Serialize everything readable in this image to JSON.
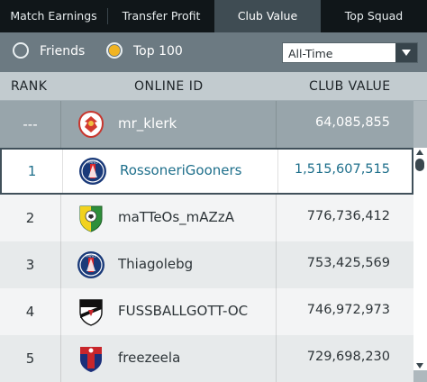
{
  "tabs": [
    {
      "label": "Match Earnings"
    },
    {
      "label": "Transfer Profit"
    },
    {
      "label": "Club Value",
      "active": true
    },
    {
      "label": "Top Squad"
    }
  ],
  "filters": {
    "friends_label": "Friends",
    "top100_label": "Top 100",
    "selected": "Top 100",
    "period_value": "All-Time"
  },
  "table": {
    "headers": {
      "rank": "RANK",
      "online_id": "ONLINE ID",
      "club_value": "CLUB VALUE"
    },
    "rows": [
      {
        "rank": "---",
        "online_id": "mr_klerk",
        "club_value": "64,085,855",
        "crest": "red-eagle-crest-icon"
      },
      {
        "rank": "1",
        "online_id": "RossoneriGooners",
        "club_value": "1,515,607,515",
        "crest": "psg-crest-icon"
      },
      {
        "rank": "2",
        "online_id": "maTTeOs_mAZzA",
        "club_value": "776,736,412",
        "crest": "green-yellow-crest-icon"
      },
      {
        "rank": "3",
        "online_id": "Thiagolebg",
        "club_value": "753,425,569",
        "crest": "psg-crest-icon"
      },
      {
        "rank": "4",
        "online_id": "FUSSBALLGOTT-OC",
        "club_value": "746,972,973",
        "crest": "vasco-crest-icon"
      },
      {
        "rank": "5",
        "online_id": "freezeela",
        "club_value": "729,698,230",
        "crest": "red-blue-crest-icon"
      }
    ]
  },
  "colors": {
    "accent_radio": "#f1b422",
    "selected_text": "#1e6f8b",
    "tab_bar": "#101619",
    "active_tab": "#3f4c53"
  }
}
